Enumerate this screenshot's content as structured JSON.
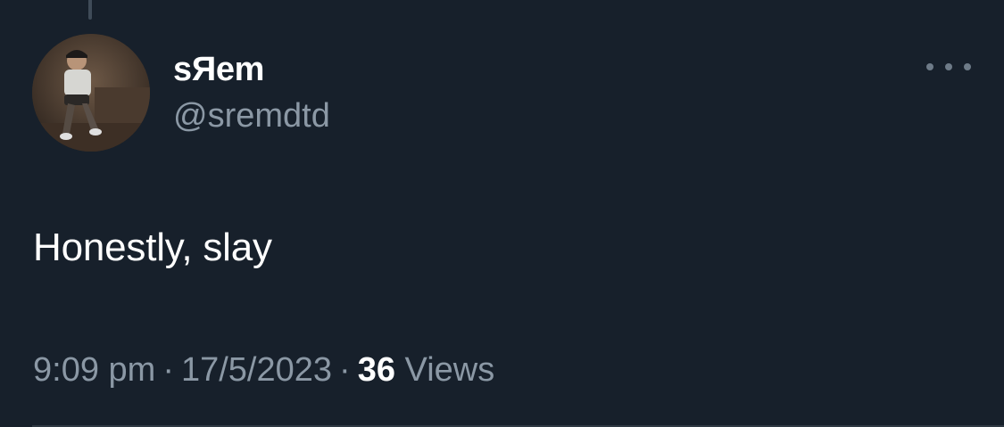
{
  "tweet": {
    "author": {
      "display_name": "sЯem",
      "handle": "@sremdtd"
    },
    "text": "Honestly, slay",
    "time": "9:09 pm",
    "date": "17/5/2023",
    "separator": "·",
    "views_count": "36",
    "views_label": "Views"
  },
  "icons": {
    "more": "more-horizontal-icon"
  },
  "colors": {
    "background": "#17202b",
    "primary_text": "#ffffff",
    "secondary_text": "#8b98a5"
  }
}
